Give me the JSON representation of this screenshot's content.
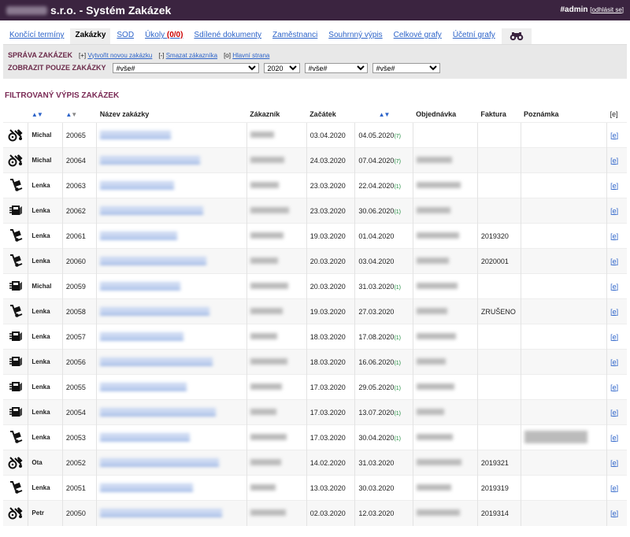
{
  "app": {
    "company_suffix": "s.r.o. - Systém Zakázek",
    "user": "#admin",
    "logout": "odhlásit se"
  },
  "tabs": [
    {
      "label": "Končící termíny",
      "active": false
    },
    {
      "label": "Zakázky",
      "active": true
    },
    {
      "label": "SOD",
      "active": false
    },
    {
      "label": "Úkoly",
      "badge": "(0/0)",
      "active": false
    },
    {
      "label": "Sdílené dokumenty",
      "active": false
    },
    {
      "label": "Zaměstnanci",
      "active": false
    },
    {
      "label": "Souhrnný výpis",
      "active": false
    },
    {
      "label": "Celkové grafy",
      "active": false
    },
    {
      "label": "Účetní grafy",
      "active": false
    }
  ],
  "panel": {
    "manage_title": "SPRÁVA ZAKÁZEK",
    "create_prefix": "[+]",
    "create_label": "Vytvořit novou zakázku",
    "delete_prefix": "[-]",
    "delete_label": "Smazat zákazníka",
    "home_prefix": "[o]",
    "home_label": "Hlavní strana",
    "filter_title": "ZOBRAZIT POUZE ZAKÁZKY",
    "filter1": "#vše#",
    "year": "2020",
    "filter2": "#vše#",
    "filter3": "#vše#"
  },
  "section_title": "FILTROVANÝ VÝPIS ZAKÁZEK",
  "columns": {
    "name": "Název zakázky",
    "customer": "Zákazník",
    "start": "Začátek",
    "order": "Objednávka",
    "invoice": "Faktura",
    "note": "Poznámka",
    "edit": "[e]"
  },
  "rows": [
    {
      "icon": "bike-tools-icon",
      "person": "Michal",
      "num": "20065",
      "start": "03.04.2020",
      "end": "04.05.2020",
      "days": "(7)",
      "invoice": "",
      "edit": "[e]"
    },
    {
      "icon": "bike-tools-icon",
      "person": "Michal",
      "num": "20064",
      "start": "24.03.2020",
      "end": "07.04.2020",
      "days": "(7)",
      "invoice": "",
      "edit": "[e]"
    },
    {
      "icon": "hand-truck-icon",
      "person": "Lenka",
      "num": "20063",
      "start": "23.03.2020",
      "end": "22.04.2020",
      "days": "(1)",
      "invoice": "",
      "edit": "[e]"
    },
    {
      "icon": "package-icon",
      "person": "Lenka",
      "num": "20062",
      "start": "23.03.2020",
      "end": "30.06.2020",
      "days": "(1)",
      "invoice": "",
      "edit": "[e]"
    },
    {
      "icon": "hand-truck-icon",
      "person": "Lenka",
      "num": "20061",
      "start": "19.03.2020",
      "end": "01.04.2020",
      "days": "",
      "invoice": "2019320",
      "edit": "[e]"
    },
    {
      "icon": "hand-truck-icon",
      "person": "Lenka",
      "num": "20060",
      "start": "20.03.2020",
      "end": "03.04.2020",
      "days": "",
      "invoice": "2020001",
      "edit": "[e]"
    },
    {
      "icon": "package-icon",
      "person": "Michal",
      "num": "20059",
      "start": "20.03.2020",
      "end": "31.03.2020",
      "days": "(1)",
      "invoice": "",
      "edit": "[e]"
    },
    {
      "icon": "hand-truck-icon",
      "person": "Lenka",
      "num": "20058",
      "start": "19.03.2020",
      "end": "27.03.2020",
      "days": "",
      "invoice": "ZRUŠENO",
      "edit": "[e]"
    },
    {
      "icon": "package-icon",
      "person": "Lenka",
      "num": "20057",
      "start": "18.03.2020",
      "end": "17.08.2020",
      "days": "(1)",
      "invoice": "",
      "edit": "[e]"
    },
    {
      "icon": "package-icon",
      "person": "Lenka",
      "num": "20056",
      "start": "18.03.2020",
      "end": "16.06.2020",
      "days": "(1)",
      "invoice": "",
      "edit": "[e]"
    },
    {
      "icon": "package-icon",
      "person": "Lenka",
      "num": "20055",
      "start": "17.03.2020",
      "end": "29.05.2020",
      "days": "(1)",
      "invoice": "",
      "edit": "[e]"
    },
    {
      "icon": "package-icon",
      "person": "Lenka",
      "num": "20054",
      "start": "17.03.2020",
      "end": "13.07.2020",
      "days": "(1)",
      "invoice": "",
      "edit": "[e]"
    },
    {
      "icon": "hand-truck-icon",
      "person": "Lenka",
      "num": "20053",
      "start": "17.03.2020",
      "end": "30.04.2020",
      "days": "(1)",
      "invoice": "",
      "edit": "[e]"
    },
    {
      "icon": "bike-tools-icon",
      "person": "Ota",
      "num": "20052",
      "start": "14.02.2020",
      "end": "31.03.2020",
      "days": "",
      "invoice": "2019321",
      "edit": "[e]"
    },
    {
      "icon": "hand-truck-icon",
      "person": "Lenka",
      "num": "20051",
      "start": "13.03.2020",
      "end": "30.03.2020",
      "days": "",
      "invoice": "2019319",
      "edit": "[e]"
    },
    {
      "icon": "bike-tools-icon",
      "person": "Petr",
      "num": "20050",
      "start": "02.03.2020",
      "end": "12.03.2020",
      "days": "",
      "invoice": "2019314",
      "edit": "[e]"
    }
  ]
}
